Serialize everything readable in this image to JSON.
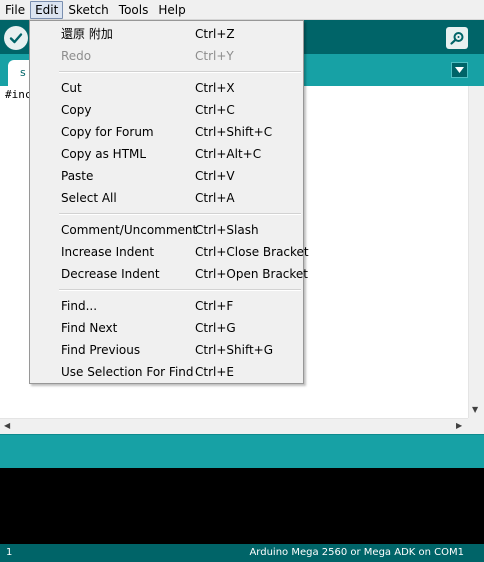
{
  "menubar": {
    "items": [
      {
        "label": "File",
        "active": false
      },
      {
        "label": "Edit",
        "active": true
      },
      {
        "label": "Sketch",
        "active": false
      },
      {
        "label": "Tools",
        "active": false
      },
      {
        "label": "Help",
        "active": false
      }
    ]
  },
  "toolbar": {
    "verify_icon": "checkmark-icon",
    "serial_monitor_icon": "magnifier-icon"
  },
  "tabs": {
    "items": [
      {
        "label": "s"
      }
    ],
    "menu_icon": "triangle-down-icon"
  },
  "editor": {
    "first_line": "#inc"
  },
  "edit_menu": {
    "groups": [
      [
        {
          "label": "還原 附加",
          "shortcut": "Ctrl+Z",
          "enabled": true
        },
        {
          "label": "Redo",
          "shortcut": "Ctrl+Y",
          "enabled": false
        }
      ],
      [
        {
          "label": "Cut",
          "shortcut": "Ctrl+X",
          "enabled": true
        },
        {
          "label": "Copy",
          "shortcut": "Ctrl+C",
          "enabled": true
        },
        {
          "label": "Copy for Forum",
          "shortcut": "Ctrl+Shift+C",
          "enabled": true
        },
        {
          "label": "Copy as HTML",
          "shortcut": "Ctrl+Alt+C",
          "enabled": true
        },
        {
          "label": "Paste",
          "shortcut": "Ctrl+V",
          "enabled": true
        },
        {
          "label": "Select All",
          "shortcut": "Ctrl+A",
          "enabled": true
        }
      ],
      [
        {
          "label": "Comment/Uncomment",
          "shortcut": "Ctrl+Slash",
          "enabled": true
        },
        {
          "label": "Increase Indent",
          "shortcut": "Ctrl+Close Bracket",
          "enabled": true
        },
        {
          "label": "Decrease Indent",
          "shortcut": "Ctrl+Open Bracket",
          "enabled": true
        }
      ],
      [
        {
          "label": "Find...",
          "shortcut": "Ctrl+F",
          "enabled": true
        },
        {
          "label": "Find Next",
          "shortcut": "Ctrl+G",
          "enabled": true
        },
        {
          "label": "Find Previous",
          "shortcut": "Ctrl+Shift+G",
          "enabled": true
        },
        {
          "label": "Use Selection For Find",
          "shortcut": "Ctrl+E",
          "enabled": true
        }
      ]
    ]
  },
  "status": {
    "line_number": "1",
    "board": "Arduino Mega 2560 or Mega ADK on COM1"
  },
  "colors": {
    "toolbar": "#006468",
    "tabstrip": "#17a1a5",
    "console": "#000000"
  }
}
